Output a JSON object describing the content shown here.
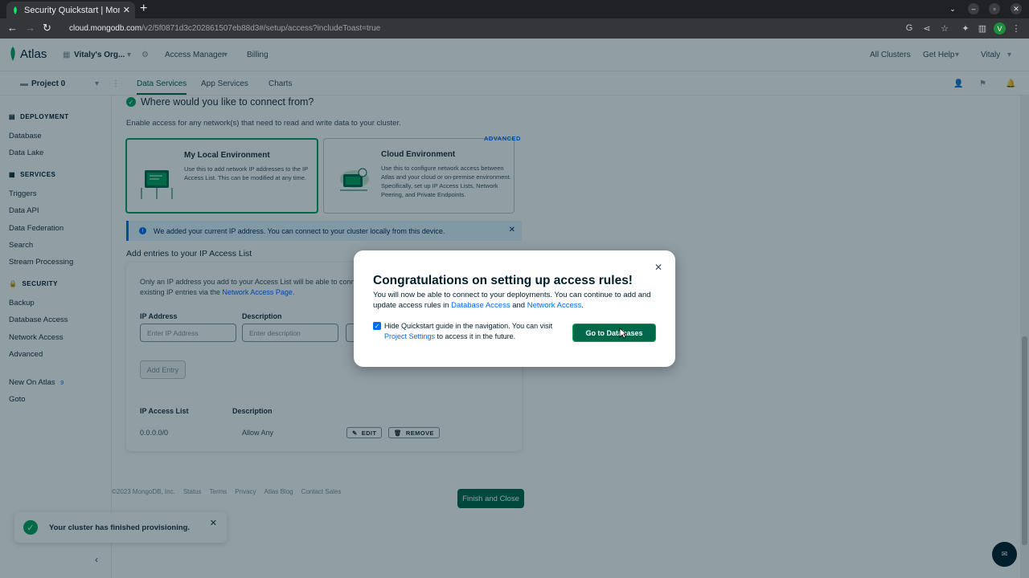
{
  "browser": {
    "tab_title": "Security Quickstart | Mon",
    "url_host": "cloud.mongodb.com",
    "url_path": "/v2/5f0871d3c202861507eb88d3#/setup/access?includeToast=true",
    "profile_letter": "V"
  },
  "topnav": {
    "logo": "Atlas",
    "org": "Vitaly's Org...",
    "access_manager": "Access Manager",
    "billing": "Billing",
    "all_clusters": "All Clusters",
    "get_help": "Get Help",
    "user": "Vitaly"
  },
  "subnav": {
    "project": "Project 0",
    "tabs": [
      "Data Services",
      "App Services",
      "Charts"
    ]
  },
  "sidebar": {
    "deployment": "DEPLOYMENT",
    "deployment_items": [
      "Database",
      "Data Lake"
    ],
    "services": "SERVICES",
    "services_items": [
      "Triggers",
      "Data API",
      "Data Federation",
      "Search",
      "Stream Processing"
    ],
    "security": "SECURITY",
    "security_items": [
      "Backup",
      "Database Access",
      "Network Access",
      "Advanced"
    ],
    "new_on_atlas": "New On Atlas",
    "new_count": "9",
    "goto": "Goto"
  },
  "main": {
    "heading": "Where would you like to connect from?",
    "description": "Enable access for any network(s) that need to read and write data to your cluster.",
    "local_title": "My Local Environment",
    "local_desc": "Use this to add network IP addresses to the IP Access List. This can be modified at any time.",
    "cloud_title": "Cloud Environment",
    "cloud_desc": "Use this to configure network access between Atlas and your cloud or on-premise environment. Specifically, set up IP Access Lists, Network Peering, and Private Endpoints.",
    "advanced": "ADVANCED",
    "banner": "We added your current IP address. You can connect to your cluster locally from this device.",
    "ip_heading": "Add entries to your IP Access List",
    "ip_text": "Only an IP address you add to your Access List will be able to conn",
    "ip_text2": "existing IP entries via the ",
    "ip_link": "Network Access Page",
    "ip_label": "IP Address",
    "desc_label": "Description",
    "ip_placeholder": "Enter IP Address",
    "desc_placeholder": "Enter description",
    "add_entry": "Add Entry",
    "list_header_ip": "IP Access List",
    "list_header_desc": "Description",
    "row_ip": "0.0.0.0/0",
    "row_desc": "Allow Any",
    "edit": "EDIT",
    "remove": "REMOVE",
    "finish": "Finish and Close"
  },
  "footer": [
    "©2023 MongoDB, Inc.",
    "Status",
    "Terms",
    "Privacy",
    "Atlas Blog",
    "Contact Sales"
  ],
  "toast": "Your cluster has finished provisioning.",
  "modal": {
    "title": "Congratulations on setting up access rules!",
    "body1": "You will now be able to connect to your deployments. You can continue to add and update access rules in ",
    "link_db": "Database Access",
    "and": " and ",
    "link_net": "Network Access",
    "period": ".",
    "checkbox_text1": "Hide Quickstart guide in the navigation. You can visit ",
    "link_settings": "Project Settings",
    "checkbox_text2": " to access it in the future.",
    "go_button": "Go to Databases"
  },
  "colors": {
    "accent": "#00684a",
    "success": "#00a35c",
    "link": "#016bf8"
  }
}
